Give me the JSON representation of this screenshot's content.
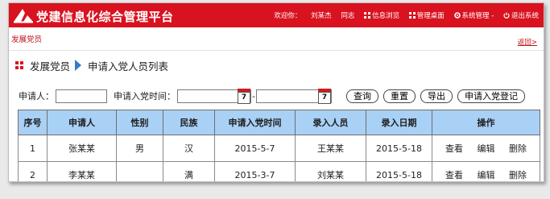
{
  "app": {
    "title": "党建信息化综合管理平台"
  },
  "userbar": {
    "welcome": "欢迎你：",
    "user": "刘某杰",
    "group": "同志",
    "items": [
      "信息浏览",
      "管理桌面",
      "系统管理 -",
      "退出系统"
    ]
  },
  "crumb": {
    "top": "发展党员",
    "back": "返回>"
  },
  "page": {
    "section": "发展党员",
    "title": "申请入党人员列表"
  },
  "search": {
    "applicant_label": "申请人：",
    "applicant_value": "",
    "time_label": "申请入党时间：",
    "date_from": "",
    "date_to": "",
    "sep": "-",
    "calendar_day": "7",
    "buttons": [
      "查询",
      "重置",
      "导出",
      "申请入党登记"
    ]
  },
  "table": {
    "columns": [
      "序号",
      "申请人",
      "性别",
      "民族",
      "申请入党时间",
      "录入人员",
      "录入日期",
      "操作"
    ],
    "rows": [
      {
        "no": "1",
        "name": "张某某",
        "gender": "男",
        "ethnicity": "汉",
        "apply_date": "2015-5-7",
        "entered_by": "王某某",
        "entry_date": "2015-5-18",
        "ops": [
          "查看",
          "编辑",
          "删除"
        ]
      },
      {
        "no": "2",
        "name": "李某某",
        "gender": "",
        "ethnicity": "满",
        "apply_date": "2015-3-7",
        "entered_by": "刘某某",
        "entry_date": "2015-5-18",
        "ops": [
          "查看",
          "编辑",
          "删除"
        ]
      }
    ]
  },
  "colors": {
    "brand": "#d9121f",
    "header": "#a9d0f5",
    "accent": "#2f7fc8"
  }
}
